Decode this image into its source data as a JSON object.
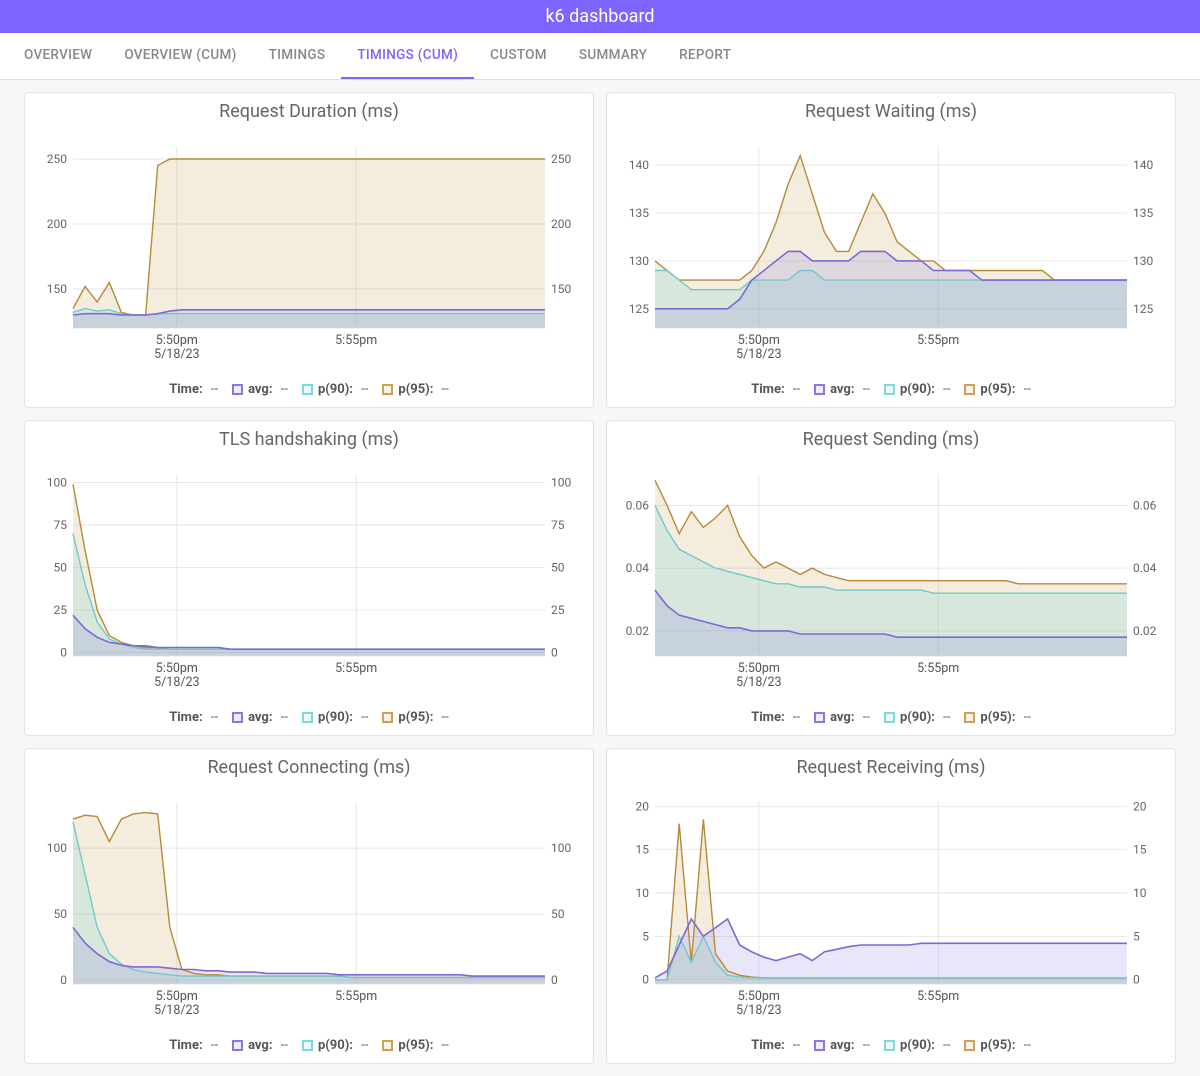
{
  "header": {
    "title": "k6 dashboard"
  },
  "tabs": [
    {
      "label": "OVERVIEW",
      "active": false
    },
    {
      "label": "OVERVIEW (CUM)",
      "active": false
    },
    {
      "label": "TIMINGS",
      "active": false
    },
    {
      "label": "TIMINGS (CUM)",
      "active": true
    },
    {
      "label": "CUSTOM",
      "active": false
    },
    {
      "label": "SUMMARY",
      "active": false
    },
    {
      "label": "REPORT",
      "active": false
    }
  ],
  "legend": {
    "time_label": "Time:",
    "time_value": "--",
    "avg_label": "avg:",
    "avg_value": "--",
    "p90_label": "p(90):",
    "p90_value": "--",
    "p95_label": "p(95):",
    "p95_value": "--"
  },
  "xaxis": {
    "ticks": [
      "5:50pm",
      "5:55pm"
    ],
    "date": "5/18/23"
  },
  "colors": {
    "avg": "#7d68d8",
    "p90": "#6fcacd",
    "p95": "#b58a38"
  },
  "chart_data": [
    {
      "id": "request-duration",
      "title": "Request Duration (ms)",
      "type": "area",
      "ylim": [
        120,
        260
      ],
      "yticks": [
        150,
        200,
        250
      ],
      "xlabel_ticks": [
        "5:50pm",
        "5:55pm"
      ],
      "x_date": "5/18/23",
      "series": [
        {
          "name": "p(95)",
          "values": [
            135,
            152,
            140,
            155,
            132,
            130,
            130,
            245,
            250,
            250,
            250,
            250,
            250,
            250,
            250,
            250,
            250,
            250,
            250,
            250,
            250,
            250,
            250,
            250,
            250,
            250,
            250,
            250,
            250,
            250,
            250,
            250,
            250,
            250,
            250,
            250,
            250,
            250,
            250,
            250
          ]
        },
        {
          "name": "p(90)",
          "values": [
            132,
            135,
            133,
            134,
            131,
            130,
            130,
            131,
            131,
            131,
            131,
            131,
            131,
            131,
            131,
            131,
            131,
            131,
            131,
            131,
            131,
            131,
            131,
            131,
            131,
            131,
            131,
            131,
            131,
            131,
            131,
            131,
            131,
            131,
            131,
            131,
            131,
            131,
            131,
            131
          ]
        },
        {
          "name": "avg",
          "values": [
            130,
            131,
            131,
            131,
            130,
            130,
            130,
            131,
            133,
            134,
            134,
            134,
            134,
            134,
            134,
            134,
            134,
            134,
            134,
            134,
            134,
            134,
            134,
            134,
            134,
            134,
            134,
            134,
            134,
            134,
            134,
            134,
            134,
            134,
            134,
            134,
            134,
            134,
            134,
            134
          ]
        }
      ]
    },
    {
      "id": "request-waiting",
      "title": "Request Waiting (ms)",
      "type": "area",
      "ylim": [
        123,
        142
      ],
      "yticks": [
        125,
        130,
        135,
        140
      ],
      "xlabel_ticks": [
        "5:50pm",
        "5:55pm"
      ],
      "x_date": "5/18/23",
      "series": [
        {
          "name": "p(95)",
          "values": [
            130,
            129,
            128,
            128,
            128,
            128,
            128,
            128,
            129,
            131,
            134,
            138,
            141,
            137,
            133,
            131,
            131,
            134,
            137,
            135,
            132,
            131,
            130,
            130,
            129,
            129,
            129,
            129,
            129,
            129,
            129,
            129,
            129,
            128,
            128,
            128,
            128,
            128,
            128,
            128
          ]
        },
        {
          "name": "p(90)",
          "values": [
            129,
            129,
            128,
            127,
            127,
            127,
            127,
            127,
            128,
            128,
            128,
            128,
            129,
            129,
            128,
            128,
            128,
            128,
            128,
            128,
            128,
            128,
            128,
            128,
            128,
            128,
            128,
            128,
            128,
            128,
            128,
            128,
            128,
            128,
            128,
            128,
            128,
            128,
            128,
            128
          ]
        },
        {
          "name": "avg",
          "values": [
            125,
            125,
            125,
            125,
            125,
            125,
            125,
            126,
            128,
            129,
            130,
            131,
            131,
            130,
            130,
            130,
            130,
            131,
            131,
            131,
            130,
            130,
            130,
            129,
            129,
            129,
            129,
            128,
            128,
            128,
            128,
            128,
            128,
            128,
            128,
            128,
            128,
            128,
            128,
            128
          ]
        }
      ]
    },
    {
      "id": "tls-handshaking",
      "title": "TLS handshaking (ms)",
      "type": "area",
      "ylim": [
        -2,
        105
      ],
      "yticks": [
        0,
        25,
        50,
        75,
        100
      ],
      "xlabel_ticks": [
        "5:50pm",
        "5:55pm"
      ],
      "x_date": "5/18/23",
      "series": [
        {
          "name": "p(95)",
          "values": [
            99,
            60,
            25,
            10,
            6,
            4,
            3,
            3,
            2,
            2,
            2,
            2,
            2,
            2,
            2,
            2,
            2,
            2,
            2,
            2,
            2,
            2,
            2,
            2,
            2,
            2,
            2,
            2,
            2,
            2,
            2,
            2,
            2,
            2,
            2,
            2,
            2,
            2,
            2,
            2
          ]
        },
        {
          "name": "p(90)",
          "values": [
            70,
            40,
            18,
            8,
            5,
            3,
            2,
            2,
            2,
            2,
            2,
            2,
            2,
            2,
            2,
            2,
            2,
            2,
            2,
            2,
            2,
            2,
            2,
            2,
            2,
            2,
            2,
            2,
            2,
            2,
            2,
            2,
            2,
            2,
            2,
            2,
            2,
            2,
            2,
            2
          ]
        },
        {
          "name": "avg",
          "values": [
            22,
            14,
            9,
            6,
            5,
            4,
            4,
            3,
            3,
            3,
            3,
            3,
            3,
            2,
            2,
            2,
            2,
            2,
            2,
            2,
            2,
            2,
            2,
            2,
            2,
            2,
            2,
            2,
            2,
            2,
            2,
            2,
            2,
            2,
            2,
            2,
            2,
            2,
            2,
            2
          ]
        }
      ]
    },
    {
      "id": "request-sending",
      "title": "Request Sending (ms)",
      "type": "area",
      "ylim": [
        0.012,
        0.07
      ],
      "yticks": [
        0.02,
        0.04,
        0.06
      ],
      "xlabel_ticks": [
        "5:50pm",
        "5:55pm"
      ],
      "x_date": "5/18/23",
      "series": [
        {
          "name": "p(95)",
          "values": [
            0.068,
            0.06,
            0.051,
            0.058,
            0.053,
            0.056,
            0.06,
            0.05,
            0.044,
            0.04,
            0.042,
            0.04,
            0.038,
            0.04,
            0.038,
            0.037,
            0.036,
            0.036,
            0.036,
            0.036,
            0.036,
            0.036,
            0.036,
            0.036,
            0.036,
            0.036,
            0.036,
            0.036,
            0.036,
            0.036,
            0.035,
            0.035,
            0.035,
            0.035,
            0.035,
            0.035,
            0.035,
            0.035,
            0.035,
            0.035
          ]
        },
        {
          "name": "p(90)",
          "values": [
            0.06,
            0.052,
            0.046,
            0.044,
            0.042,
            0.04,
            0.039,
            0.038,
            0.037,
            0.036,
            0.035,
            0.035,
            0.034,
            0.034,
            0.034,
            0.033,
            0.033,
            0.033,
            0.033,
            0.033,
            0.033,
            0.033,
            0.033,
            0.032,
            0.032,
            0.032,
            0.032,
            0.032,
            0.032,
            0.032,
            0.032,
            0.032,
            0.032,
            0.032,
            0.032,
            0.032,
            0.032,
            0.032,
            0.032,
            0.032
          ]
        },
        {
          "name": "avg",
          "values": [
            0.033,
            0.028,
            0.025,
            0.024,
            0.023,
            0.022,
            0.021,
            0.021,
            0.02,
            0.02,
            0.02,
            0.02,
            0.019,
            0.019,
            0.019,
            0.019,
            0.019,
            0.019,
            0.019,
            0.019,
            0.018,
            0.018,
            0.018,
            0.018,
            0.018,
            0.018,
            0.018,
            0.018,
            0.018,
            0.018,
            0.018,
            0.018,
            0.018,
            0.018,
            0.018,
            0.018,
            0.018,
            0.018,
            0.018,
            0.018
          ]
        }
      ]
    },
    {
      "id": "request-connecting",
      "title": "Request Connecting (ms)",
      "type": "area",
      "ylim": [
        -3,
        135
      ],
      "yticks": [
        0,
        50,
        100
      ],
      "xlabel_ticks": [
        "5:50pm",
        "5:55pm"
      ],
      "x_date": "5/18/23",
      "series": [
        {
          "name": "p(95)",
          "values": [
            122,
            125,
            124,
            105,
            122,
            126,
            127,
            126,
            40,
            8,
            5,
            4,
            4,
            3,
            3,
            3,
            3,
            3,
            3,
            3,
            3,
            3,
            3,
            2,
            2,
            2,
            2,
            2,
            2,
            2,
            2,
            2,
            2,
            2,
            2,
            2,
            2,
            2,
            2,
            2
          ]
        },
        {
          "name": "p(90)",
          "values": [
            120,
            80,
            40,
            20,
            12,
            8,
            6,
            5,
            4,
            3,
            3,
            3,
            3,
            3,
            3,
            3,
            3,
            3,
            3,
            3,
            3,
            3,
            3,
            2,
            2,
            2,
            2,
            2,
            2,
            2,
            2,
            2,
            2,
            2,
            2,
            2,
            2,
            2,
            2,
            2
          ]
        },
        {
          "name": "avg",
          "values": [
            40,
            28,
            20,
            14,
            11,
            10,
            10,
            10,
            9,
            8,
            8,
            7,
            7,
            6,
            6,
            6,
            5,
            5,
            5,
            5,
            5,
            5,
            4,
            4,
            4,
            4,
            4,
            4,
            4,
            4,
            4,
            4,
            4,
            3,
            3,
            3,
            3,
            3,
            3,
            3
          ]
        }
      ]
    },
    {
      "id": "request-receiving",
      "title": "Request Receiving (ms)",
      "type": "area",
      "ylim": [
        -0.5,
        20.5
      ],
      "yticks": [
        0,
        5,
        10,
        15,
        20
      ],
      "xlabel_ticks": [
        "5:50pm",
        "5:55pm"
      ],
      "x_date": "5/18/23",
      "series": [
        {
          "name": "p(95)",
          "values": [
            0,
            0,
            18,
            2,
            18.5,
            3,
            1,
            0.5,
            0.3,
            0.2,
            0.2,
            0.2,
            0.2,
            0.2,
            0.2,
            0.2,
            0.2,
            0.2,
            0.2,
            0.2,
            0.2,
            0.2,
            0.2,
            0.2,
            0.2,
            0.2,
            0.2,
            0.2,
            0.2,
            0.2,
            0.2,
            0.2,
            0.2,
            0.2,
            0.2,
            0.2,
            0.2,
            0.2,
            0.2,
            0.2
          ]
        },
        {
          "name": "p(90)",
          "values": [
            0,
            0,
            5,
            2,
            5,
            2,
            0.5,
            0.3,
            0.2,
            0.2,
            0.2,
            0.2,
            0.2,
            0.2,
            0.2,
            0.2,
            0.2,
            0.2,
            0.2,
            0.2,
            0.2,
            0.2,
            0.2,
            0.2,
            0.2,
            0.2,
            0.2,
            0.2,
            0.2,
            0.2,
            0.2,
            0.2,
            0.2,
            0.2,
            0.2,
            0.2,
            0.2,
            0.2,
            0.2,
            0.2
          ]
        },
        {
          "name": "avg",
          "values": [
            0.2,
            1,
            4,
            7,
            5,
            6,
            7,
            4,
            3.2,
            2.6,
            2.2,
            2.6,
            3.0,
            2.2,
            3.2,
            3.5,
            3.8,
            4.0,
            4.0,
            4.0,
            4.0,
            4.0,
            4.2,
            4.2,
            4.2,
            4.2,
            4.2,
            4.2,
            4.2,
            4.2,
            4.2,
            4.2,
            4.2,
            4.2,
            4.2,
            4.2,
            4.2,
            4.2,
            4.2,
            4.2
          ]
        }
      ]
    }
  ]
}
